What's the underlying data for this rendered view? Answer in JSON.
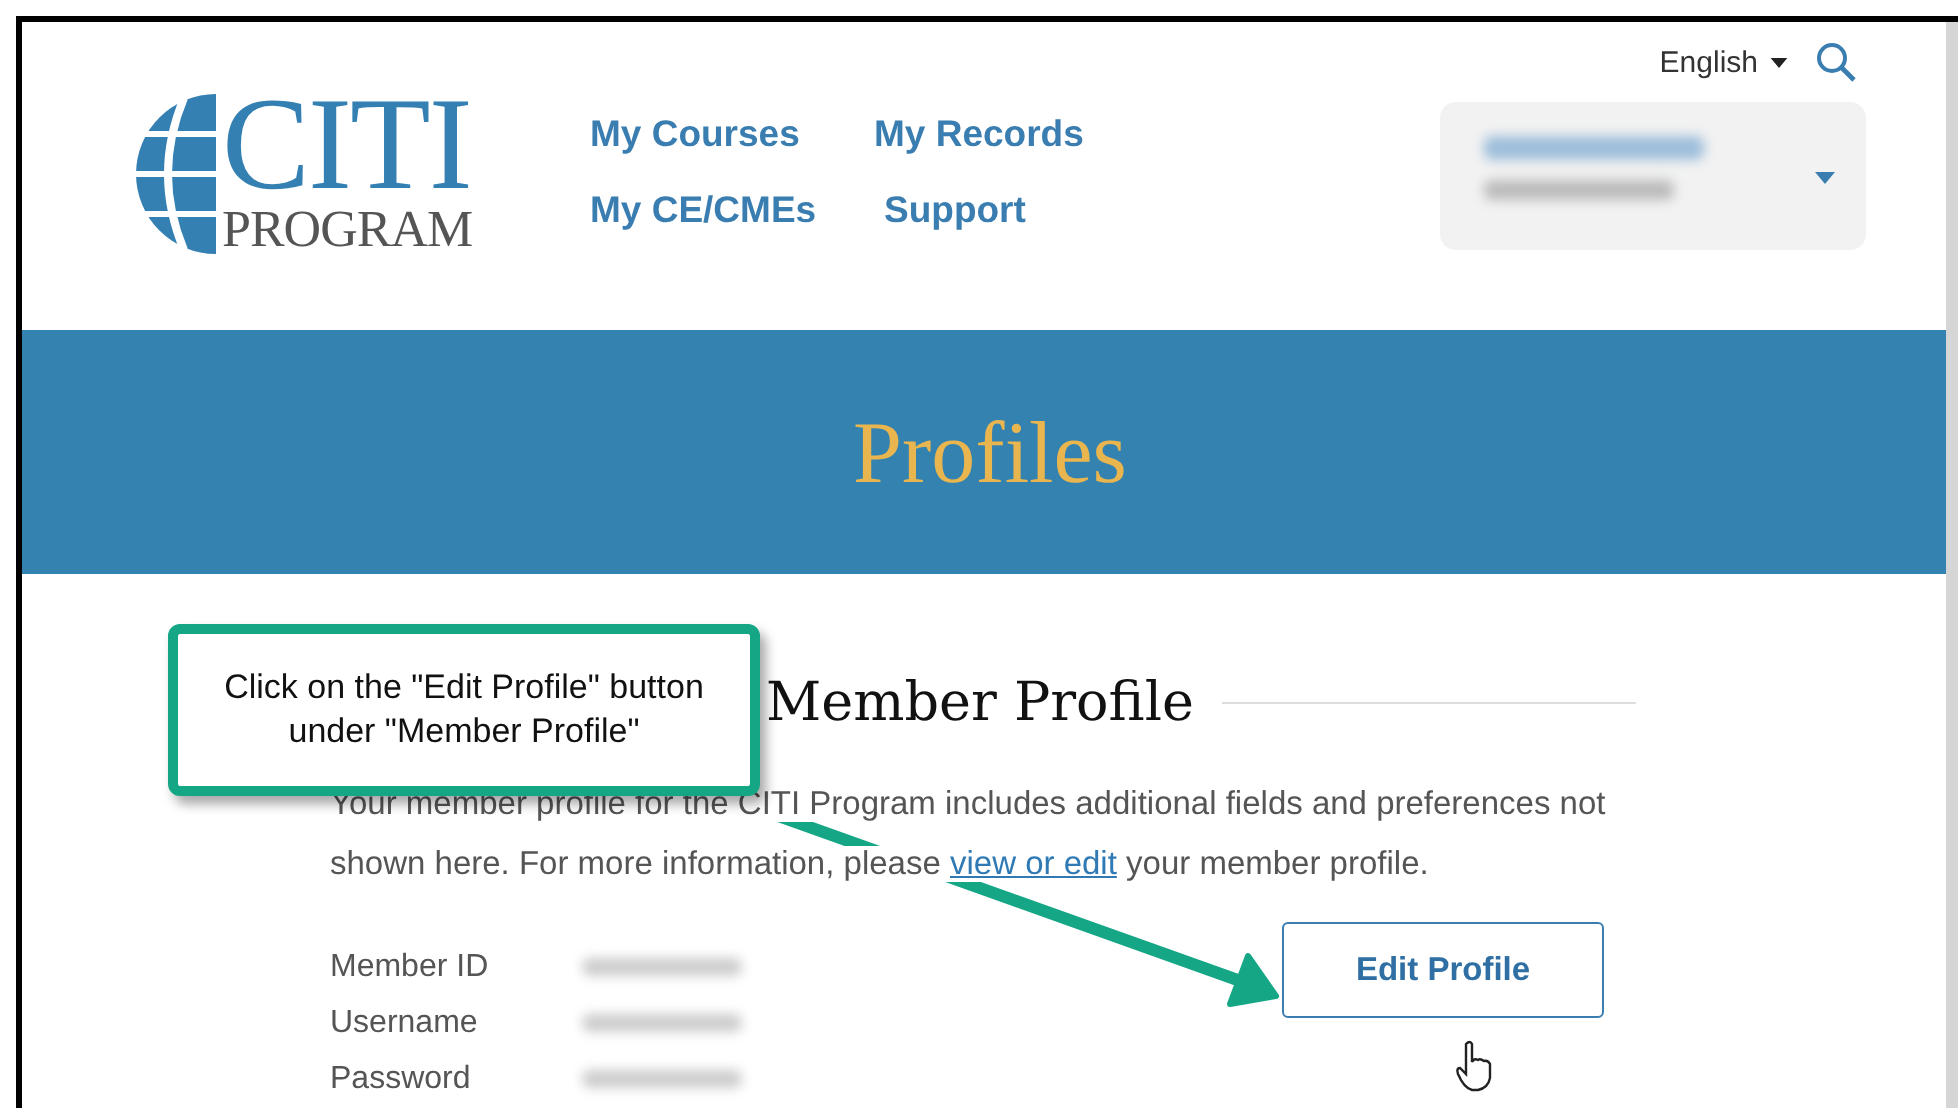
{
  "logo": {
    "title": "CITI",
    "subtitle": "PROGRAM"
  },
  "nav": [
    {
      "label": "My Courses"
    },
    {
      "label": "My Records"
    },
    {
      "label": "My CE/CMEs"
    },
    {
      "label": "Support"
    }
  ],
  "language": {
    "label": "English"
  },
  "banner": {
    "title": "Profiles"
  },
  "member_profile": {
    "heading": "Member Profile",
    "description": "Your member profile for the CITI Program includes additional fields and preferences not shown here. For more information, please ",
    "link": "view or edit",
    "description_end": " your member profile.",
    "fields": [
      {
        "label": "Member ID"
      },
      {
        "label": "Username"
      },
      {
        "label": "Password"
      }
    ],
    "button": "Edit Profile"
  },
  "callout": {
    "text": "Click on the \"Edit Profile\" button under \"Member Profile\""
  }
}
